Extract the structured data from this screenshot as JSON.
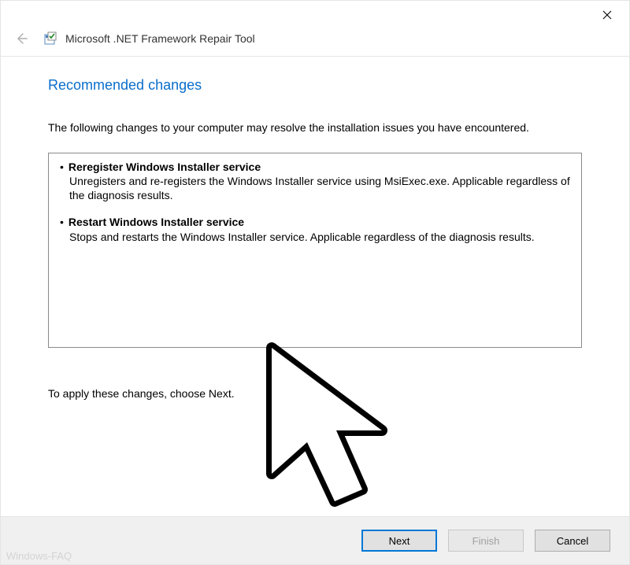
{
  "header": {
    "app_title": "Microsoft .NET Framework Repair Tool"
  },
  "main": {
    "heading": "Recommended changes",
    "intro": "The following changes to your computer may resolve the installation issues you have encountered.",
    "changes": [
      {
        "title": "Reregister Windows Installer service",
        "description": "Unregisters and re-registers the Windows Installer service using MsiExec.exe. Applicable regardless of the diagnosis results."
      },
      {
        "title": "Restart Windows Installer service",
        "description": "Stops and restarts the Windows Installer service. Applicable regardless of the diagnosis results."
      }
    ],
    "apply_hint": "To apply these changes, choose Next."
  },
  "footer": {
    "next_label": "Next",
    "finish_label": "Finish",
    "cancel_label": "Cancel"
  },
  "watermark": "Windows-FAQ"
}
